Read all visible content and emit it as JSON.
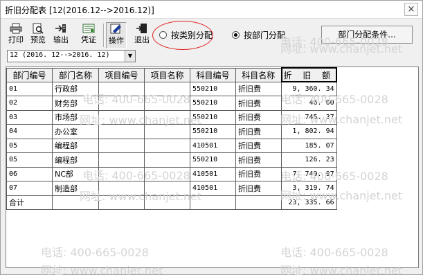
{
  "window": {
    "title": "折旧分配表 [12(2016.12-->2016.12)]",
    "close_glyph": "×"
  },
  "toolbar": {
    "print": "打印",
    "preview": "预览",
    "export": "输出",
    "voucher": "凭证",
    "operate": "操作",
    "exit": "退出"
  },
  "options": {
    "by_category": "按类别分配",
    "by_department": "按部门分配",
    "selected": "by_department",
    "condition_button": "部门分配条件..."
  },
  "period_combo": {
    "value": "12 (2016. 12-->2016. 12)"
  },
  "table": {
    "headers": [
      "部门编号",
      "部门名称",
      "项目编号",
      "项目名称",
      "科目编号",
      "科目名称",
      "折 旧 额"
    ],
    "rows": [
      [
        "01",
        "行政部",
        "",
        "",
        "550210",
        "折旧费",
        "9, 360. 34"
      ],
      [
        "02",
        "财务部",
        "",
        "",
        "550210",
        "折旧费",
        "46. 00"
      ],
      [
        "03",
        "市场部",
        "",
        "",
        "550210",
        "折旧费",
        "745. 37"
      ],
      [
        "04",
        "办公室",
        "",
        "",
        "550210",
        "折旧费",
        "1, 802. 94"
      ],
      [
        "05",
        "编程部",
        "",
        "",
        "410501",
        "折旧费",
        "185. 07"
      ],
      [
        "05",
        "编程部",
        "",
        "",
        "550210",
        "折旧费",
        "126. 23"
      ],
      [
        "06",
        "NC部",
        "",
        "",
        "410501",
        "折旧费",
        "7, 749. 97"
      ],
      [
        "07",
        "制造部",
        "",
        "",
        "410501",
        "折旧费",
        "3, 319. 74"
      ]
    ],
    "total_label": "合计",
    "total_value": "23, 335. 66"
  },
  "watermarks": {
    "phone": "电话: 400-665-0028",
    "url": "网址: www.chanjet.net"
  }
}
